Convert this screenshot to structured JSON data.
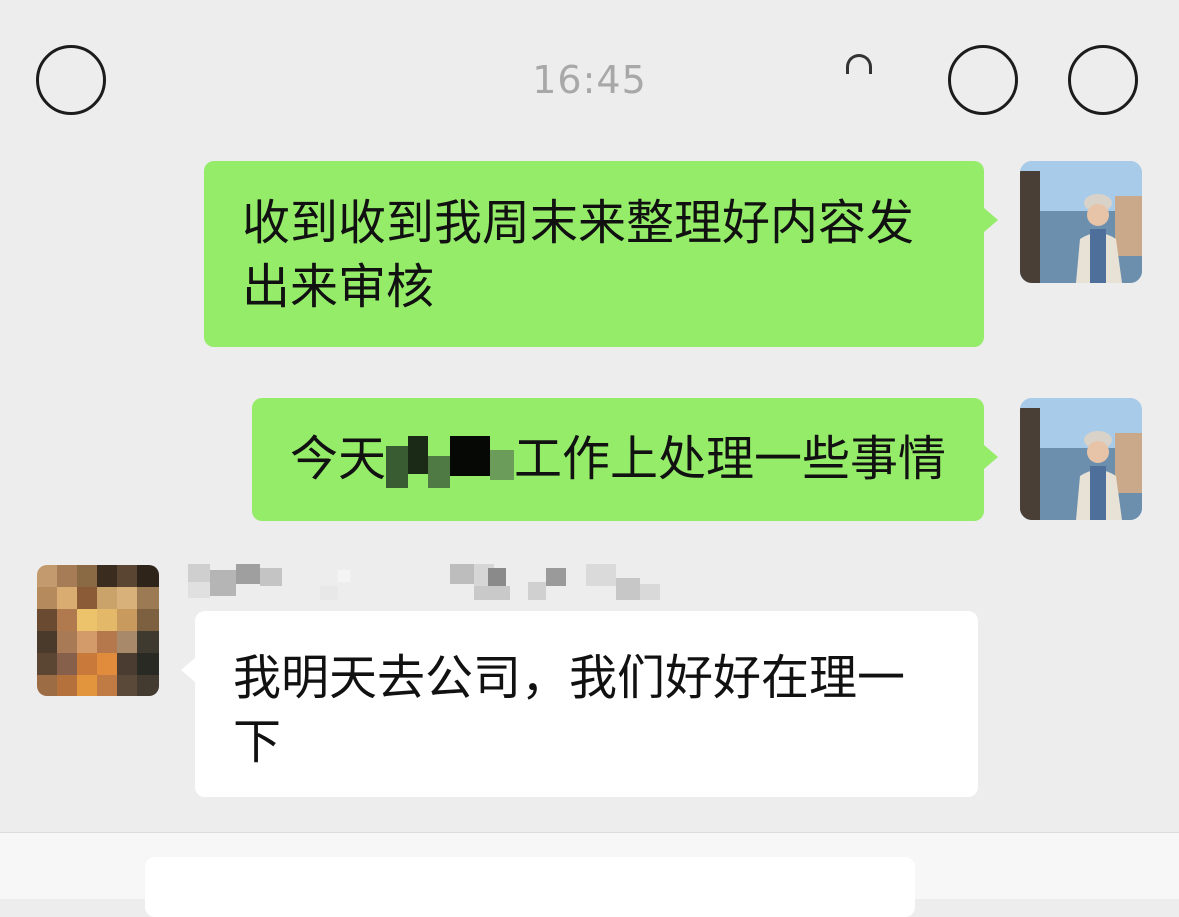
{
  "chat": {
    "timestamp": "16:45",
    "messages": [
      {
        "direction": "outgoing",
        "text": "收到收到我周末来整理好内容发出来审核"
      },
      {
        "direction": "outgoing",
        "text_before": "今天",
        "text_after": "工作上处理一些事情",
        "has_redaction": true
      },
      {
        "direction": "incoming",
        "text": "我明天去公司，我们好好在理一下"
      }
    ]
  },
  "input_bar": {
    "left_icon": "voice-icon",
    "right_icons": [
      "emoji-icon",
      "plus-icon"
    ]
  },
  "colors": {
    "background": "#ededed",
    "outgoing_bubble": "#95ec69",
    "incoming_bubble": "#ffffff",
    "timestamp_text": "#a8a8a8"
  }
}
